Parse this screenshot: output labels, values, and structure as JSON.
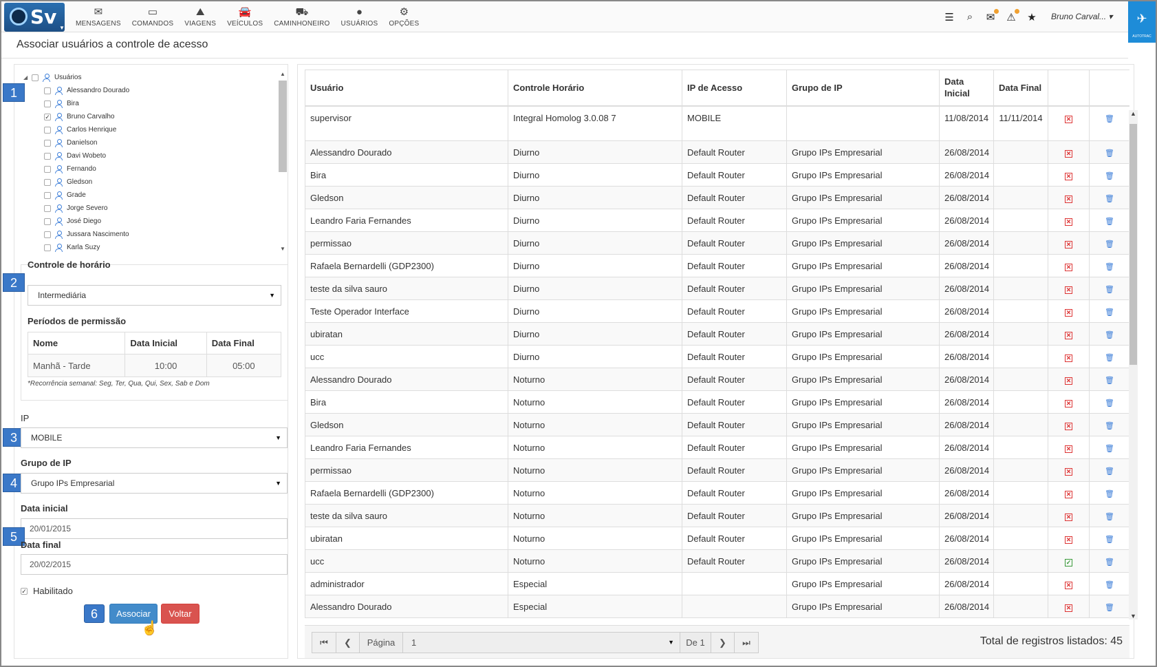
{
  "nav": {
    "logo": "Sv",
    "items": [
      {
        "label": "MENSAGENS",
        "icon": "envelope-icon"
      },
      {
        "label": "COMANDOS",
        "icon": "laptop-icon"
      },
      {
        "label": "VIAGENS",
        "icon": "road-icon"
      },
      {
        "label": "VEÍCULOS",
        "icon": "car-icon"
      },
      {
        "label": "CAMINHONEIRO",
        "icon": "truck-icon"
      },
      {
        "label": "USUÁRIOS",
        "icon": "user-icon"
      },
      {
        "label": "OPÇÕES",
        "icon": "gears-icon"
      }
    ],
    "user": "Bruno Carval...",
    "brand": "AUTOTRAC"
  },
  "page": {
    "title": "Associar usuários a controle de acesso"
  },
  "tree": {
    "root": "Usuários",
    "users": [
      {
        "name": "Alessandro Dourado",
        "checked": false
      },
      {
        "name": "Bira",
        "checked": false
      },
      {
        "name": "Bruno Carvalho",
        "checked": true
      },
      {
        "name": "Carlos Henrique",
        "checked": false
      },
      {
        "name": "Danielson",
        "checked": false
      },
      {
        "name": "Davi Wobeto",
        "checked": false
      },
      {
        "name": "Fernando",
        "checked": false
      },
      {
        "name": "Gledson",
        "checked": false
      },
      {
        "name": "Grade",
        "checked": false
      },
      {
        "name": "Jorge Severo",
        "checked": false
      },
      {
        "name": "José Diego",
        "checked": false
      },
      {
        "name": "Jussara Nascimento",
        "checked": false
      },
      {
        "name": "Karla Suzy",
        "checked": false
      }
    ]
  },
  "steps": [
    "1",
    "2",
    "3",
    "4",
    "5",
    "6"
  ],
  "form": {
    "controle_label": "Controle de horário",
    "controle_value": "Intermediária",
    "periodos_label": "Períodos de permissão",
    "periodos_headers": [
      "Nome",
      "Data Inicial",
      "Data Final"
    ],
    "periodos_row": [
      "Manhã - Tarde",
      "10:00",
      "05:00"
    ],
    "recorrencia": "*Recorrência semanal: Seg, Ter, Qua, Qui, Sex, Sab e Dom",
    "ip_label": "IP",
    "ip_value": "MOBILE",
    "grupo_label": "Grupo de IP",
    "grupo_value": "Grupo IPs Empresarial",
    "data_inicial_label": "Data inicial",
    "data_inicial_value": "20/01/2015",
    "data_final_label": "Data final",
    "data_final_value": "20/02/2015",
    "habilitado_label": "Habilitado",
    "associar": "Associar",
    "voltar": "Voltar"
  },
  "grid": {
    "headers": [
      "Usuário",
      "Controle Horário",
      "IP de Acesso",
      "Grupo de IP",
      "Data Inicial",
      "Data Final",
      "",
      ""
    ],
    "rows": [
      [
        "supervisor",
        "Integral Homolog 3.0.08 7",
        "MOBILE",
        "",
        "11/08/2014",
        "11/11/2014",
        "x"
      ],
      [
        "Alessandro Dourado",
        "Diurno",
        "Default Router",
        "Grupo IPs Empresarial",
        "26/08/2014",
        "",
        "x"
      ],
      [
        "Bira",
        "Diurno",
        "Default Router",
        "Grupo IPs Empresarial",
        "26/08/2014",
        "",
        "x"
      ],
      [
        "Gledson",
        "Diurno",
        "Default Router",
        "Grupo IPs Empresarial",
        "26/08/2014",
        "",
        "x"
      ],
      [
        "Leandro Faria Fernandes",
        "Diurno",
        "Default Router",
        "Grupo IPs Empresarial",
        "26/08/2014",
        "",
        "x"
      ],
      [
        "permissao",
        "Diurno",
        "Default Router",
        "Grupo IPs Empresarial",
        "26/08/2014",
        "",
        "x"
      ],
      [
        "Rafaela Bernardelli (GDP2300)",
        "Diurno",
        "Default Router",
        "Grupo IPs Empresarial",
        "26/08/2014",
        "",
        "x"
      ],
      [
        "teste da silva sauro",
        "Diurno",
        "Default Router",
        "Grupo IPs Empresarial",
        "26/08/2014",
        "",
        "x"
      ],
      [
        "Teste Operador Interface",
        "Diurno",
        "Default Router",
        "Grupo IPs Empresarial",
        "26/08/2014",
        "",
        "x"
      ],
      [
        "ubiratan",
        "Diurno",
        "Default Router",
        "Grupo IPs Empresarial",
        "26/08/2014",
        "",
        "x"
      ],
      [
        "ucc",
        "Diurno",
        "Default Router",
        "Grupo IPs Empresarial",
        "26/08/2014",
        "",
        "x"
      ],
      [
        "Alessandro Dourado",
        "Noturno",
        "Default Router",
        "Grupo IPs Empresarial",
        "26/08/2014",
        "",
        "x"
      ],
      [
        "Bira",
        "Noturno",
        "Default Router",
        "Grupo IPs Empresarial",
        "26/08/2014",
        "",
        "x"
      ],
      [
        "Gledson",
        "Noturno",
        "Default Router",
        "Grupo IPs Empresarial",
        "26/08/2014",
        "",
        "x"
      ],
      [
        "Leandro Faria Fernandes",
        "Noturno",
        "Default Router",
        "Grupo IPs Empresarial",
        "26/08/2014",
        "",
        "x"
      ],
      [
        "permissao",
        "Noturno",
        "Default Router",
        "Grupo IPs Empresarial",
        "26/08/2014",
        "",
        "x"
      ],
      [
        "Rafaela Bernardelli (GDP2300)",
        "Noturno",
        "Default Router",
        "Grupo IPs Empresarial",
        "26/08/2014",
        "",
        "x"
      ],
      [
        "teste da silva sauro",
        "Noturno",
        "Default Router",
        "Grupo IPs Empresarial",
        "26/08/2014",
        "",
        "x"
      ],
      [
        "ubiratan",
        "Noturno",
        "Default Router",
        "Grupo IPs Empresarial",
        "26/08/2014",
        "",
        "x"
      ],
      [
        "ucc",
        "Noturno",
        "Default Router",
        "Grupo IPs Empresarial",
        "26/08/2014",
        "",
        "ok"
      ],
      [
        "administrador",
        "Especial",
        "",
        "Grupo IPs Empresarial",
        "26/08/2014",
        "",
        "x"
      ],
      [
        "Alessandro Dourado",
        "Especial",
        "",
        "Grupo IPs Empresarial",
        "26/08/2014",
        "",
        "x"
      ]
    ]
  },
  "pager": {
    "page_label": "Página",
    "page_value": "1",
    "of_label": "De 1",
    "total": "Total de registros listados: 45"
  },
  "colors": {
    "primary": "#428bca",
    "danger": "#d9534f",
    "badge": "#3a78c8",
    "brand": "#1e8cd8"
  }
}
